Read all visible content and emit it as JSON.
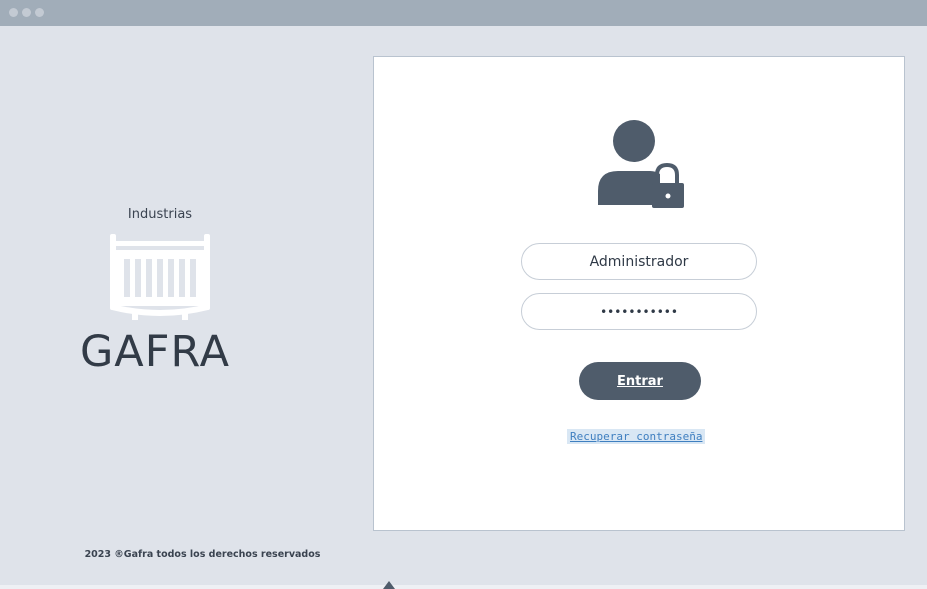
{
  "window": {
    "controls": [
      "close-dot",
      "minimize-dot",
      "maximize-dot"
    ]
  },
  "brand": {
    "subtitle": "Industrias",
    "name": "GAFRA",
    "logo_icon": "crib-icon"
  },
  "login": {
    "avatar_icon": "user-lock-icon",
    "username_value": "Administrador",
    "password_value": "•••••••••••",
    "submit_label": "Entrar",
    "recover_label": "Recuperar contraseña"
  },
  "footer": {
    "copyright": "2023 ®Gafra todos los derechos reservados"
  },
  "colors": {
    "accent": "#4f5c6b",
    "titlebar": "#a1adb9",
    "background": "#dfe3ea",
    "link": "#3f7fc0"
  }
}
